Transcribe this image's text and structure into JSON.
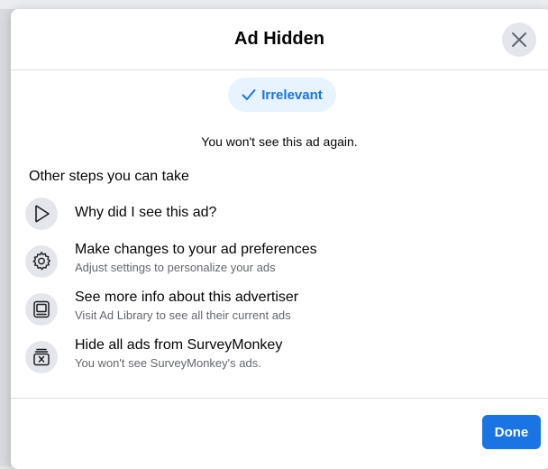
{
  "dialog": {
    "title": "Ad Hidden",
    "close_icon": "close-icon"
  },
  "reason_chip": {
    "label": "Irrelevant",
    "icon": "checkmark-icon"
  },
  "confirmation": "You won't see this ad again.",
  "other_steps": {
    "heading": "Other steps you can take",
    "items": [
      {
        "icon": "play-outline-icon",
        "title": "Why did I see this ad?",
        "subtitle": ""
      },
      {
        "icon": "gear-icon",
        "title": "Make changes to your ad preferences",
        "subtitle": "Adjust settings to personalize your ads"
      },
      {
        "icon": "ad-library-icon",
        "title": "See more info about this advertiser",
        "subtitle": "Visit Ad Library to see all their current ads"
      },
      {
        "icon": "hide-box-icon",
        "title": "Hide all ads from SurveyMonkey",
        "subtitle": "You won't see SurveyMonkey's ads."
      }
    ]
  },
  "footer": {
    "done_label": "Done"
  },
  "colors": {
    "accent": "#1b74e4",
    "chip_bg": "#e7f3ff",
    "icon_bg": "#e4e6eb",
    "secondary_text": "#65676b"
  }
}
